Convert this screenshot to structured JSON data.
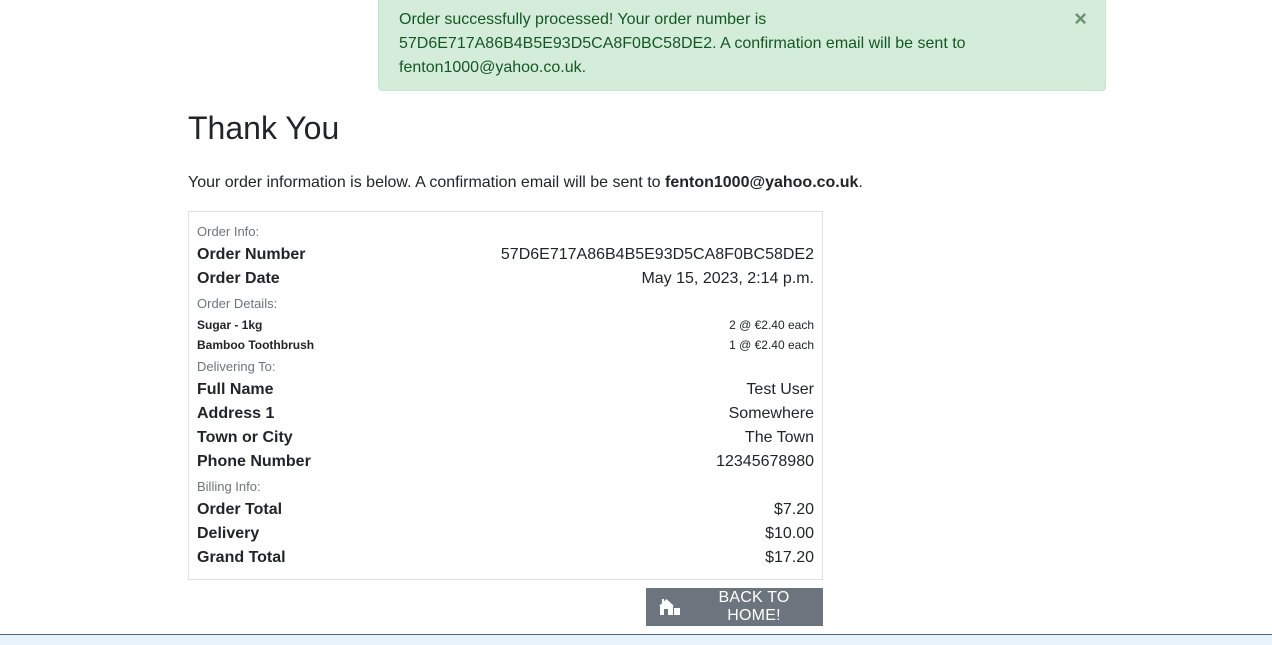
{
  "alert": {
    "message": "Order successfully processed! Your order number is 57D6E717A86B4B5E93D5CA8F0BC58DE2. A confirmation email will be sent to fenton1000@yahoo.co.uk.",
    "close_glyph": "×"
  },
  "page": {
    "title": "Thank You",
    "intro_prefix": "Your order information is below. A confirmation email will be sent to",
    "intro_email": "fenton1000@yahoo.co.uk",
    "intro_suffix": "."
  },
  "order_info": {
    "section_label": "Order Info:",
    "order_number_label": "Order Number",
    "order_number": "57D6E717A86B4B5E93D5CA8F0BC58DE2",
    "order_date_label": "Order Date",
    "order_date": "May 15, 2023, 2:14 p.m."
  },
  "order_details": {
    "section_label": "Order Details:",
    "items": [
      {
        "name": "Sugar - 1kg",
        "qty_price": "2 @ €2.40 each"
      },
      {
        "name": "Bamboo Toothbrush",
        "qty_price": "1 @ €2.40 each"
      }
    ]
  },
  "delivery": {
    "section_label": "Delivering To:",
    "full_name_label": "Full Name",
    "full_name": "Test User",
    "address1_label": "Address 1",
    "address1": "Somewhere",
    "town_label": "Town or City",
    "town": "The Town",
    "phone_label": "Phone Number",
    "phone": "12345678980"
  },
  "billing": {
    "section_label": "Billing Info:",
    "order_total_label": "Order Total",
    "order_total": "$7.20",
    "delivery_label": "Delivery",
    "delivery": "$10.00",
    "grand_total_label": "Grand Total",
    "grand_total": "$17.20"
  },
  "actions": {
    "home_label": "BACK TO HOME!",
    "home_icon": "home-icon"
  },
  "colors": {
    "alert_bg": "#d4edda",
    "alert_text": "#155724",
    "button_bg": "#6c757d"
  }
}
